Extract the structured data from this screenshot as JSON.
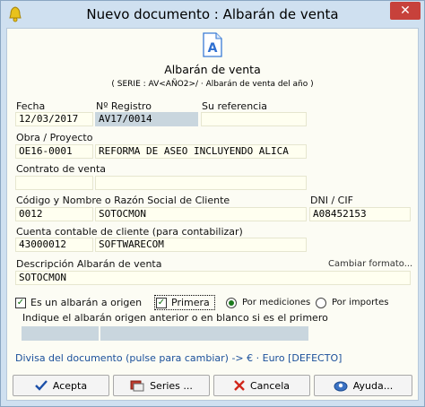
{
  "window": {
    "title": "Nuevo documento : Albarán de venta"
  },
  "header": {
    "title": "Albarán de venta",
    "subtitle": "( SERIE : AV<AÑO2>/ · Albarán de venta del año )"
  },
  "labels": {
    "fecha": "Fecha",
    "registro": "Nº Registro",
    "referencia": "Su referencia",
    "obra": "Obra / Proyecto",
    "contrato": "Contrato de venta",
    "cliente": "Código y Nombre o Razón Social de Cliente",
    "dni": "DNI / CIF",
    "cuenta": "Cuenta contable de cliente (para contabilizar)",
    "descripcion": "Descripción Albarán de venta",
    "cambiar_formato": "Cambiar formato...",
    "indique": "Indique el albarán origen anterior o en blanco si es el primero"
  },
  "fields": {
    "fecha": "12/03/2017",
    "registro": "AV17/0014",
    "referencia": "",
    "obra_codigo": "OE16-0001",
    "obra_nombre": "REFORMA DE ASEO INCLUYENDO ALICA",
    "contrato_codigo": "",
    "contrato_nombre": "",
    "cliente_codigo": "0012",
    "cliente_nombre": "SOTOCMON",
    "dni": "A08452153",
    "cuenta_codigo": "43000012",
    "cuenta_nombre": "SOFTWARECOM",
    "descripcion": "SOTOCMON",
    "origen_codigo": "",
    "origen_nombre": ""
  },
  "options": {
    "es_origen": {
      "label": "Es un albarán a origen",
      "checked": true
    },
    "primera": {
      "label": "Primera",
      "checked": true
    },
    "por_mediciones": {
      "label": "Por mediciones",
      "selected": true
    },
    "por_importes": {
      "label": "Por importes",
      "selected": false
    }
  },
  "divisa": "Divisa del documento (pulse para cambiar) -> € · Euro [DEFECTO]",
  "buttons": {
    "acepta": "Acepta",
    "series": "Series ...",
    "cancela": "Cancela",
    "ayuda": "Ayuda..."
  },
  "icons": {
    "app": "yellow-bell-icon",
    "document": "document-a-icon",
    "acepta": "check-icon",
    "series": "series-icon",
    "cancela": "red-x-icon",
    "ayuda": "help-icon"
  },
  "colors": {
    "accent": "#1a4f9a",
    "close": "#c7413b",
    "field_bg": "#fffff0"
  }
}
